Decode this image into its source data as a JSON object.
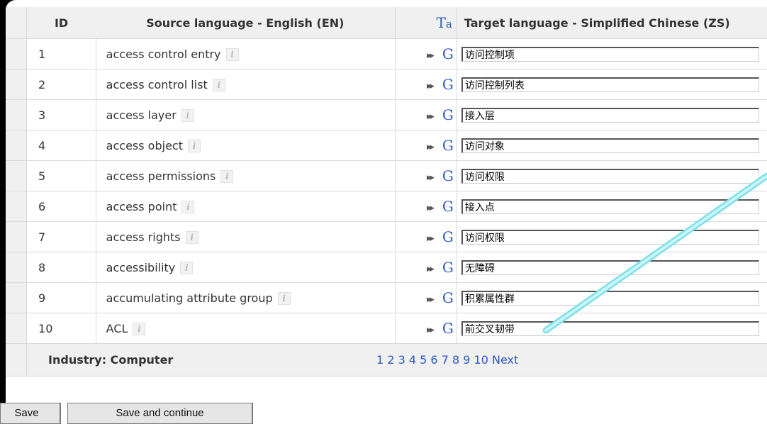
{
  "columns": {
    "id": "ID",
    "source": "Source language - English (EN)",
    "target": "Target language - Simplified Chinese (ZS)"
  },
  "icons": {
    "ta_icon": "font-switch-icon",
    "info_icon": "info-icon",
    "copy_icon": "copy-source-arrows-icon",
    "google_icon": "google-translate-icon",
    "info_glyph": "i",
    "copy_glyph": "▶▶",
    "google_glyph": "G",
    "ta_big": "T",
    "ta_small": "a"
  },
  "rows": [
    {
      "id": "1",
      "source": "access control entry",
      "target": "访问控制项"
    },
    {
      "id": "2",
      "source": "access control list",
      "target": "访问控制列表"
    },
    {
      "id": "3",
      "source": "access layer",
      "target": "接入层"
    },
    {
      "id": "4",
      "source": "access object",
      "target": "访问对象"
    },
    {
      "id": "5",
      "source": "access permissions",
      "target": "访问权限"
    },
    {
      "id": "6",
      "source": "access point",
      "target": "接入点"
    },
    {
      "id": "7",
      "source": "access rights",
      "target": "访问权限"
    },
    {
      "id": "8",
      "source": "accessibility",
      "target": "无障碍"
    },
    {
      "id": "9",
      "source": "accumulating attribute group",
      "target": "积累属性群"
    },
    {
      "id": "10",
      "source": "ACL",
      "target": "前交叉韧带"
    }
  ],
  "footer": {
    "industry": "Industry: Computer",
    "pages": [
      "1",
      "2",
      "3",
      "4",
      "5",
      "6",
      "7",
      "8",
      "9",
      "10"
    ],
    "next": "Next"
  },
  "buttons": {
    "save": "Save",
    "save_continue": "Save and continue"
  },
  "colors": {
    "link": "#2c58c0",
    "header_bg": "#f0f0f0",
    "annotation_line": "#b8f0f8"
  }
}
